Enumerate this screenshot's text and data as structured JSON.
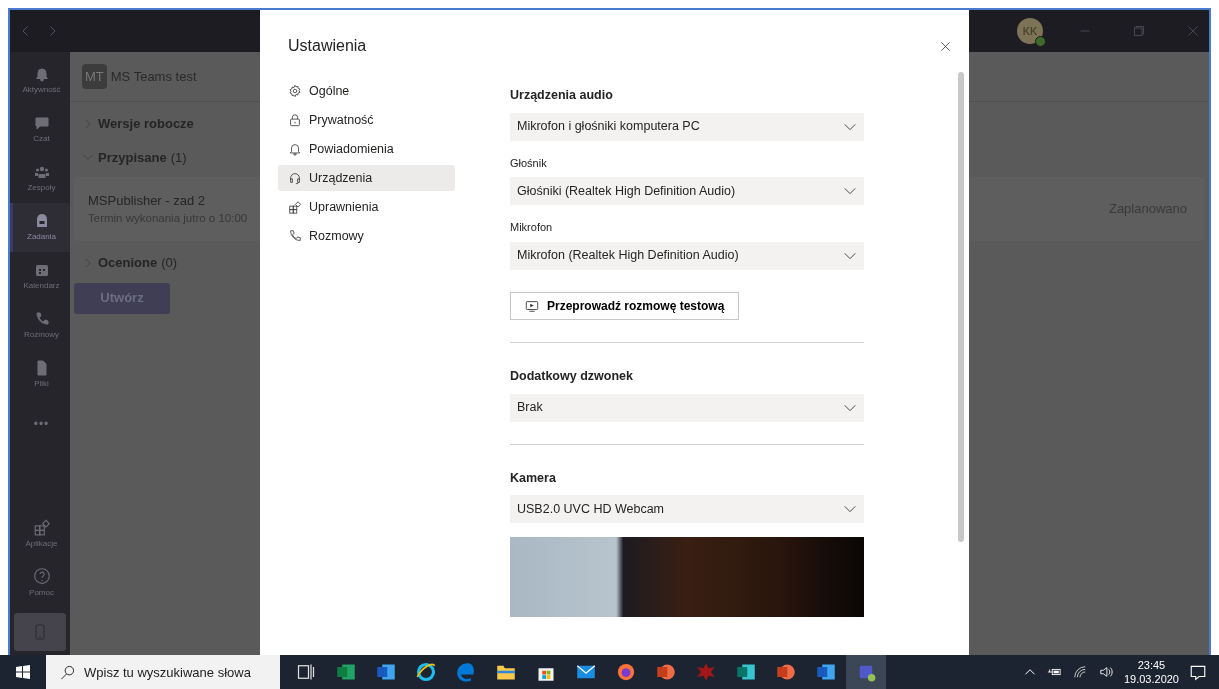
{
  "window": {
    "avatar": "KK",
    "status_online": true
  },
  "rail": [
    {
      "label": "Aktywność",
      "kind": "bell",
      "selected": false
    },
    {
      "label": "Czat",
      "kind": "chat",
      "selected": false
    },
    {
      "label": "Zespoły",
      "kind": "team",
      "selected": false
    },
    {
      "label": "Zadania",
      "kind": "bag",
      "selected": true
    },
    {
      "label": "Kalendarz",
      "kind": "calendar",
      "selected": false
    },
    {
      "label": "Rozmowy",
      "kind": "phone",
      "selected": false
    },
    {
      "label": "Pliki",
      "kind": "file",
      "selected": false
    },
    {
      "label": "•••",
      "kind": "more",
      "selected": false
    }
  ],
  "rail_bottom": [
    {
      "label": "Aplikacje",
      "kind": "apps"
    },
    {
      "label": "Pomoc",
      "kind": "help"
    }
  ],
  "team": {
    "badge": "MT",
    "name": "MS Teams test"
  },
  "sections": [
    {
      "title": "Wersje robocze",
      "expanded": false
    },
    {
      "title": "Przypisane",
      "count": "(1)",
      "expanded": true,
      "items": [
        {
          "title": "MSPublisher - zad 2",
          "due": "Termin wykonania jutro o 10:00",
          "status": "Zaplanowano"
        }
      ]
    },
    {
      "title": "Ocenione",
      "count": "(0)",
      "expanded": false
    }
  ],
  "create_button": "Utwórz",
  "settings": {
    "title": "Ustawienia",
    "nav": [
      {
        "label": "Ogólne",
        "kind": "gear",
        "selected": false
      },
      {
        "label": "Prywatność",
        "kind": "lock",
        "selected": false
      },
      {
        "label": "Powiadomienia",
        "kind": "bell",
        "selected": false
      },
      {
        "label": "Urządzenia",
        "kind": "headset",
        "selected": true
      },
      {
        "label": "Uprawnienia",
        "kind": "apps",
        "selected": false
      },
      {
        "label": "Rozmowy",
        "kind": "phone",
        "selected": false
      }
    ],
    "audio_heading": "Urządzenia audio",
    "audio_device": "Mikrofon i głośniki komputera PC",
    "speaker_label": "Głośnik",
    "speaker": "Głośniki (Realtek High Definition Audio)",
    "mic_label": "Mikrofon",
    "mic": "Mikrofon (Realtek High Definition Audio)",
    "test_button": "Przeprowadź rozmowę testową",
    "ringer_heading": "Dodatkowy dzwonek",
    "ringer": "Brak",
    "camera_heading": "Kamera",
    "camera": "USB2.0 UVC HD Webcam"
  },
  "taskbar": {
    "search_placeholder": "Wpisz tu wyszukiwane słowa",
    "apps": [
      {
        "kind": "taskview",
        "active": false
      },
      {
        "kind": "excel",
        "active": false
      },
      {
        "kind": "word",
        "active": false
      },
      {
        "kind": "ie",
        "active": false
      },
      {
        "kind": "edge",
        "active": false
      },
      {
        "kind": "folder",
        "active": false
      },
      {
        "kind": "store",
        "active": false
      },
      {
        "kind": "mail",
        "active": false
      },
      {
        "kind": "firefox",
        "active": false
      },
      {
        "kind": "powerpoint",
        "active": false
      },
      {
        "kind": "bug",
        "active": false
      },
      {
        "kind": "publisher",
        "active": false
      },
      {
        "kind": "powerpoint",
        "active": false
      },
      {
        "kind": "word",
        "active": false
      },
      {
        "kind": "teams",
        "active": true
      }
    ],
    "time": "23:45",
    "date": "19.03.2020"
  }
}
